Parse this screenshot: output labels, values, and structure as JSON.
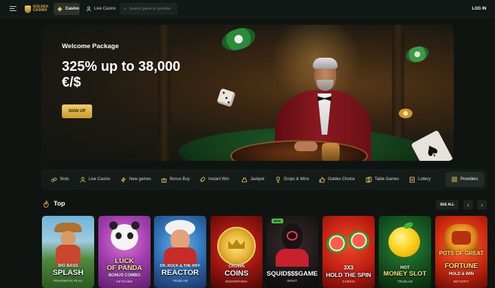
{
  "header": {
    "logo_text_1": "GOLDEX",
    "logo_text_2": "CASINO",
    "tabs": [
      {
        "label": "Casino",
        "active": true,
        "icon": "spade-icon"
      },
      {
        "label": "Live Casino",
        "active": false,
        "icon": "dealer-icon"
      }
    ],
    "search_placeholder": "Search game or provider",
    "login_label": "LOG IN"
  },
  "hero": {
    "subtitle": "Welcome Package",
    "title": "325% up to 38,000 €/$",
    "cta_label": "SIGN UP"
  },
  "categories": {
    "items": [
      {
        "label": "Slots",
        "icon": "slots-icon"
      },
      {
        "label": "Live Casino",
        "icon": "dealer-icon"
      },
      {
        "label": "New games",
        "icon": "lightning-icon"
      },
      {
        "label": "Bonus Buy",
        "icon": "gift-icon"
      },
      {
        "label": "Instant Win",
        "icon": "rocket-icon"
      },
      {
        "label": "Jackpot",
        "icon": "moneybag-icon"
      },
      {
        "label": "Drops & Wins",
        "icon": "trophy-icon"
      },
      {
        "label": "Goldex Choice",
        "icon": "thumbs-up-icon"
      },
      {
        "label": "Table Games",
        "icon": "cards-icon"
      },
      {
        "label": "Lottery",
        "icon": "ticket-icon"
      }
    ],
    "providers_label": "Providers"
  },
  "top_section": {
    "title": "Top",
    "see_all_label": "SEE ALL",
    "games": [
      {
        "pre": "BIG BASS",
        "title": "SPLASH",
        "provider": "PRAGMATIC PLAY",
        "new": false
      },
      {
        "pre": "LUCK",
        "title": "OF PANDA",
        "sub": "BONUS COMBO",
        "provider": "NETGAME",
        "new": false
      },
      {
        "pre": "DR. ROCK & THE RIFF",
        "title": "REACTOR",
        "provider": "TRUELAB",
        "new": false
      },
      {
        "pre": "CROWN",
        "title": "COINS",
        "provider": "ENDORPHINA",
        "new": false
      },
      {
        "pre": "",
        "title": "SQUID$$$GAME",
        "provider": "INOUT",
        "new": true,
        "new_label": "NEW"
      },
      {
        "pre": "3X3",
        "title": "HOLD THE SPIN",
        "provider": "GAMZIX",
        "new": false
      },
      {
        "pre": "HOT",
        "title": "MONEY SLOT",
        "provider": "TRUELAB",
        "new": false
      },
      {
        "pre": "POTS OF GREAT",
        "title": "FORTUNE",
        "sub": "HOLD & WIN",
        "provider": "BETSOFT",
        "new": false
      }
    ]
  }
}
